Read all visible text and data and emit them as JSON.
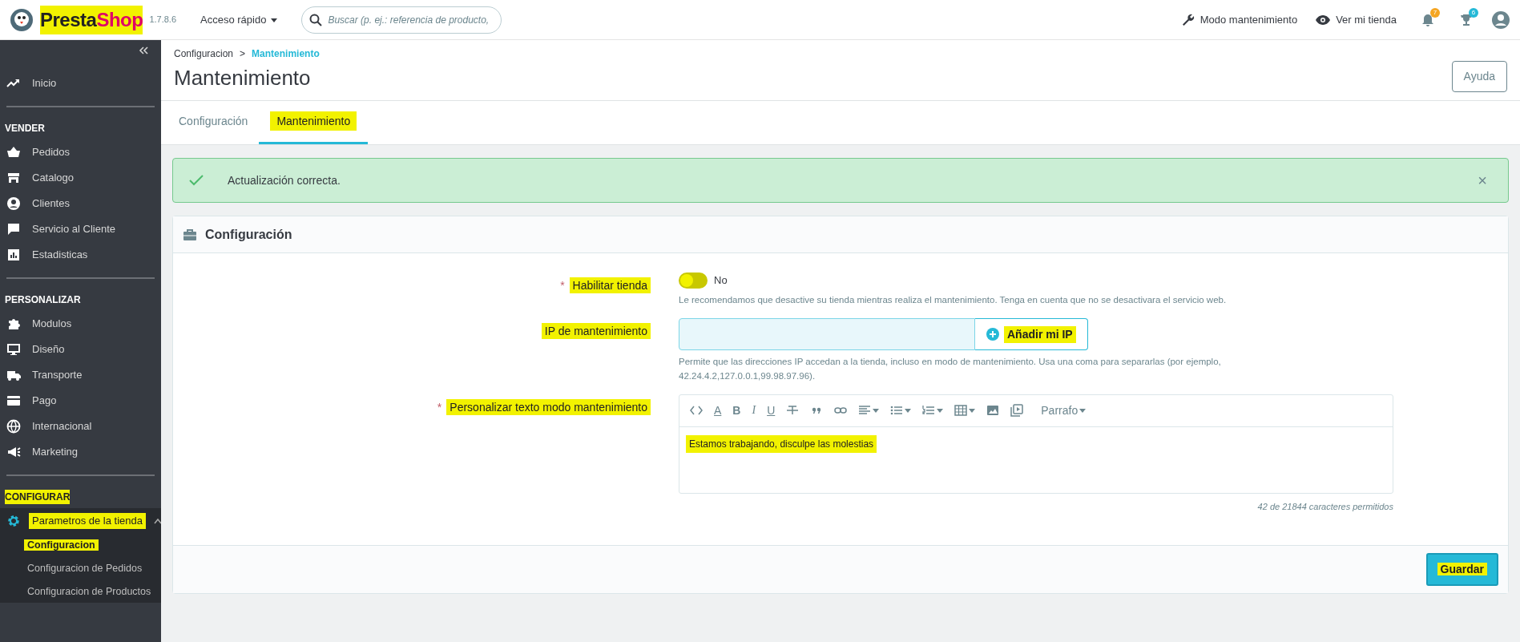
{
  "topbar": {
    "logo": [
      "Presta",
      "Shop"
    ],
    "logo_highlighted": true,
    "version": "1.7.8.6",
    "quick_access": "Acceso rápido",
    "search": {
      "placeholder": "Buscar (p. ej.: referencia de producto,"
    },
    "links": [
      "Modo mantenimiento",
      "Ver mi tienda"
    ],
    "badges": [
      {
        "text": "7",
        "color": "#f5a623"
      },
      {
        "text": "6",
        "color": "#25b9d7"
      }
    ]
  },
  "sidebar": {
    "sections": [
      {
        "items": [
          {
            "label": "Inicio",
            "selected": false,
            "highlighted": false
          }
        ]
      },
      {
        "title": "VENDER",
        "highlighted": false,
        "items": [
          {
            "label": "Pedidos",
            "selected": false,
            "highlighted": false
          },
          {
            "label": "Catalogo",
            "selected": false,
            "highlighted": false
          },
          {
            "label": "Clientes",
            "selected": false,
            "highlighted": false
          },
          {
            "label": "Servicio al Cliente",
            "selected": false,
            "highlighted": false
          },
          {
            "label": "Estadisticas",
            "selected": false,
            "highlighted": false
          }
        ]
      },
      {
        "title": "PERSONALIZAR",
        "highlighted": false,
        "items": [
          {
            "label": "Modulos",
            "selected": false,
            "highlighted": false
          },
          {
            "label": "Diseño",
            "selected": false,
            "highlighted": false
          },
          {
            "label": "Transporte",
            "selected": false,
            "highlighted": false
          },
          {
            "label": "Pago",
            "selected": false,
            "highlighted": false
          },
          {
            "label": "Internacional",
            "selected": false,
            "highlighted": false
          },
          {
            "label": "Marketing",
            "selected": false,
            "highlighted": false
          }
        ]
      },
      {
        "title": "CONFIGURAR",
        "highlighted": true,
        "items": [
          {
            "label": "Parametros de la tienda",
            "selected": true,
            "highlighted": true,
            "expanded": true,
            "children": [
              {
                "label": "Configuracion",
                "selected": true,
                "highlighted": true
              },
              {
                "label": "Configuracion de Pedidos",
                "selected": false,
                "highlighted": false
              },
              {
                "label": "Configuracion de Productos",
                "selected": false,
                "highlighted": false
              }
            ]
          }
        ]
      }
    ]
  },
  "breadcrumb": {
    "parent": "Configuracion",
    "separator": ">",
    "current": "Mantenimiento"
  },
  "page_title": "Mantenimiento",
  "help_button": "Ayuda",
  "tabs": [
    {
      "label": "Configuración",
      "selected": false,
      "highlighted": false
    },
    {
      "label": "Mantenimiento",
      "selected": true,
      "highlighted": true
    }
  ],
  "alert": {
    "text": "Actualización correcta.",
    "close": "×"
  },
  "card": {
    "title": "Configuración",
    "required_mark": "*",
    "fields": [
      {
        "kind": "switch",
        "label": "Habilitar tienda",
        "required": true,
        "highlighted": true,
        "on": false,
        "value_label": "No",
        "help": "Le recomendamos que desactive su tienda mientras realiza el mantenimiento. Tenga en cuenta que no se desactivara el servicio web."
      },
      {
        "kind": "ip",
        "label": "IP de mantenimiento",
        "required": false,
        "highlighted": true,
        "button": "Añadir mi IP",
        "button_highlighted": true,
        "help": "Permite que las direcciones IP accedan a la tienda, incluso en modo de mantenimiento. Usa una coma para separarlas (por ejemplo, 42.24.4.2,127.0.0.1,99.98.97.96)."
      },
      {
        "kind": "editor",
        "label": "Personalizar texto modo mantenimiento",
        "required": true,
        "highlighted": true,
        "toolbar_letters": [
          "A",
          "B",
          "I",
          "U"
        ],
        "format": "Parrafo",
        "content": "Estamos trabajando, disculpe las molestias",
        "content_highlighted": true,
        "counter": "42 de 21844 caracteres permitidos"
      }
    ],
    "save_button": "Guardar",
    "save_highlighted": true
  }
}
